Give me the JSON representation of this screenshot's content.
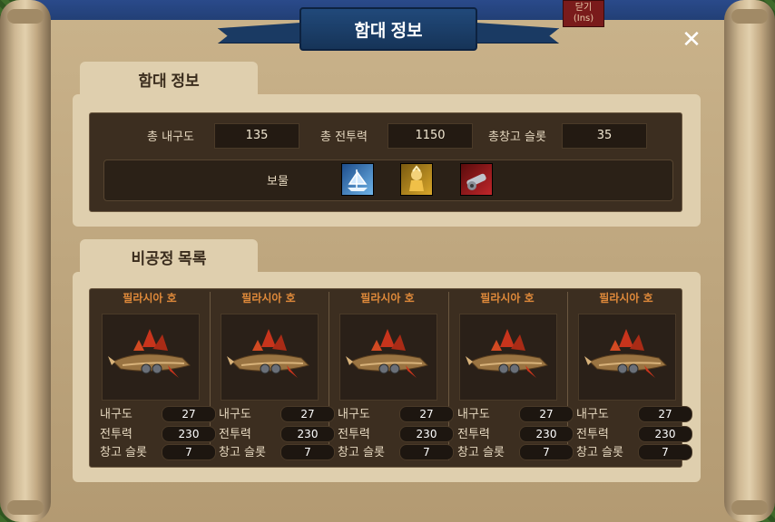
{
  "window": {
    "title": "함대 정보",
    "shortcut_label_top": "닫기",
    "shortcut_label_bottom": "(Ins)",
    "close_symbol": "✕"
  },
  "fleet_info": {
    "tab_label": "함대 정보",
    "total_durability_label": "총 내구도",
    "total_durability_value": "135",
    "total_combat_label": "총 전투력",
    "total_combat_value": "1150",
    "total_cargo_label": "총창고 슬롯",
    "total_cargo_value": "35",
    "treasure_label": "보물",
    "treasures": [
      {
        "icon": "ice-ship-treasure-icon",
        "color": "#6fb4e8"
      },
      {
        "icon": "golden-knight-treasure-icon",
        "color": "#d8a62a"
      },
      {
        "icon": "cannon-treasure-icon",
        "color": "#c0262a"
      }
    ]
  },
  "airship_list": {
    "tab_label": "비공정 목록",
    "ships": [
      {
        "name": "필라시아 호",
        "durability_label": "내구도",
        "durability": "27",
        "combat_label": "전투력",
        "combat": "230",
        "cargo_label": "창고 슬롯",
        "cargo": "7"
      },
      {
        "name": "필라시아 호",
        "durability_label": "내구도",
        "durability": "27",
        "combat_label": "전투력",
        "combat": "230",
        "cargo_label": "창고 슬롯",
        "cargo": "7"
      },
      {
        "name": "필라시아 호",
        "durability_label": "내구도",
        "durability": "27",
        "combat_label": "전투력",
        "combat": "230",
        "cargo_label": "창고 슬롯",
        "cargo": "7"
      },
      {
        "name": "필라시아 호",
        "durability_label": "내구도",
        "durability": "27",
        "combat_label": "전투력",
        "combat": "230",
        "cargo_label": "창고 슬롯",
        "cargo": "7"
      },
      {
        "name": "필라시아 호",
        "durability_label": "내구도",
        "durability": "27",
        "combat_label": "전투력",
        "combat": "230",
        "cargo_label": "창고 슬롯",
        "cargo": "7"
      }
    ]
  }
}
